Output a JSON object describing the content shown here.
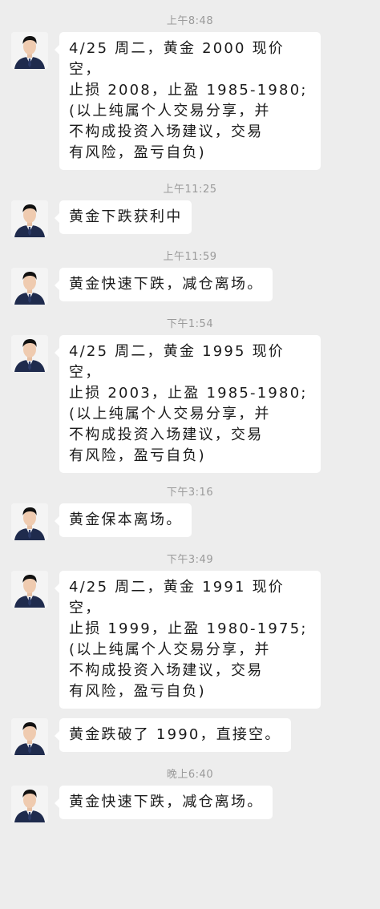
{
  "messages": [
    {
      "time": "上午8:48",
      "text": "4/25 周二，黄金 2000 现价空，\n止损 2008，止盈 1985-1980;\n(以上纯属个人交易分享，并\n不构成投资入场建议，交易\n有风险，盈亏自负)",
      "wide": true
    },
    {
      "time": "上午11:25",
      "text": "黄金下跌获利中",
      "wide": false
    },
    {
      "time": "上午11:59",
      "text": "黄金快速下跌，减仓离场。",
      "wide": false
    },
    {
      "time": "下午1:54",
      "text": "4/25 周二，黄金 1995 现价空，\n止损 2003，止盈 1985-1980;\n(以上纯属个人交易分享，并\n不构成投资入场建议，交易\n有风险，盈亏自负)",
      "wide": true
    },
    {
      "time": "下午3:16",
      "text": "黄金保本离场。",
      "wide": false
    },
    {
      "time": "下午3:49",
      "text": "4/25 周二，黄金 1991 现价空，\n止损 1999，止盈 1980-1975;\n(以上纯属个人交易分享，并\n不构成投资入场建议，交易\n有风险，盈亏自负)",
      "wide": true
    },
    {
      "time": "",
      "text": "黄金跌破了 1990，直接空。",
      "wide": false
    },
    {
      "time": "晚上6:40",
      "text": "黄金快速下跌，减仓离场。",
      "wide": false
    }
  ],
  "colors": {
    "background": "#ededed",
    "bubble": "#ffffff",
    "timestamp": "#9a9a9a",
    "text": "#1a1a1a"
  },
  "icons": {
    "avatar": "avatar-icon"
  }
}
